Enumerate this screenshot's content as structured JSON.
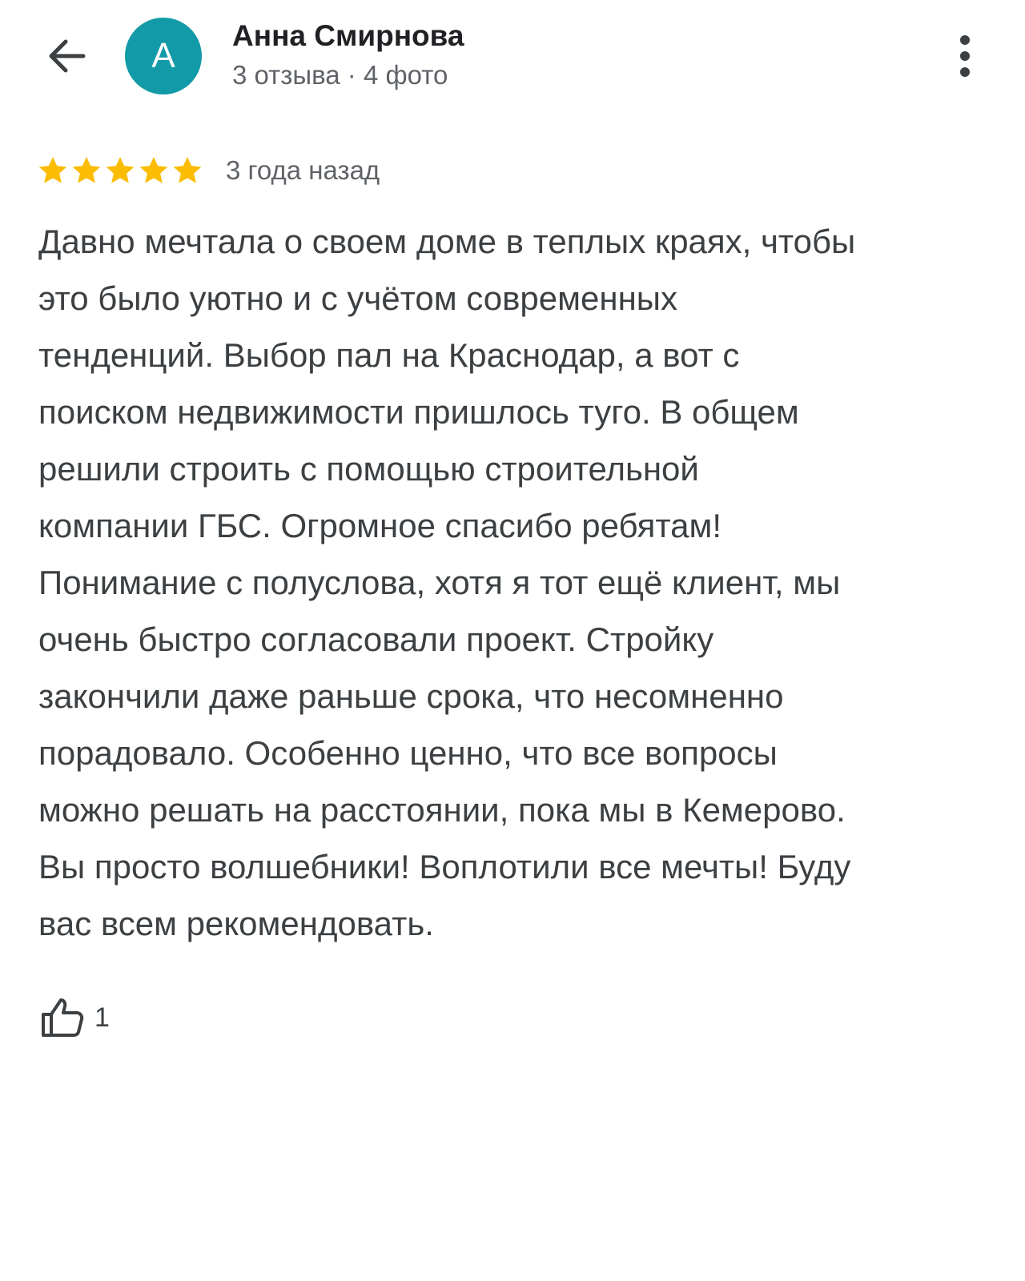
{
  "author": {
    "initial": "А",
    "name": "Анна Смирнова",
    "meta": "3 отзыва · 4 фото",
    "avatar_color": "#139aa8"
  },
  "review": {
    "rating": 5,
    "max_rating": 5,
    "date": "3 года назад",
    "lines": [
      "Давно мечтала о своем доме в теплых краях, чтобы",
      "это было уютно и с учётом современных",
      "тенденций. Выбор пал на Краснодар, а вот с",
      "поиском недвижимости пришлось туго. В общем",
      "решили строить с помощью строительной",
      "компании ГБС. Огромное спасибо ребятам!",
      "Понимание с полуслова, хотя я тот ещё клиент, мы",
      "очень быстро согласовали проект. Стройку",
      "закончили даже раньше срока, что несомненно",
      "порадовало. Особенно ценно, что все вопросы",
      "можно решать на расстоянии, пока мы в Кемерово.",
      "Вы просто волшебники! Воплотили все мечты! Буду",
      "вас всем рекомендовать."
    ],
    "likes": "1"
  },
  "icons": {
    "back": "arrow-left-icon",
    "more": "more-vertical-icon",
    "star": "star-icon",
    "like": "thumb-up-icon"
  },
  "colors": {
    "star": "#fbbc04",
    "icon": "#3c4043"
  }
}
